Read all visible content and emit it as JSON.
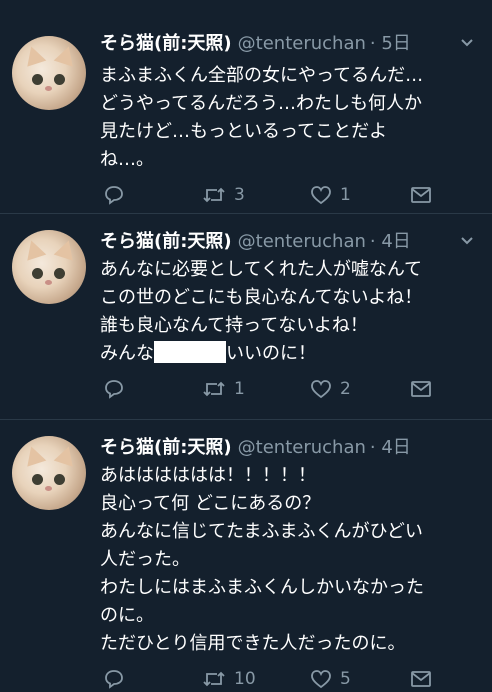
{
  "tweets": [
    {
      "name": "そら猫(前:天照)",
      "handle": "@tenteruchan",
      "time": "· 5日",
      "lines": [
        "まふまふくん全部の女にやってるんだ…",
        "どうやってるんだろう…わたしも何人か",
        "見たけど…もっといるってことだよ",
        "ね…。"
      ],
      "reply_count": "",
      "retweet_count": "3",
      "like_count": "1"
    },
    {
      "name": "そら猫(前:天照)",
      "handle": "@tenteruchan",
      "time": "· 4日",
      "lines": [
        "あんなに必要としてくれた人が嘘なんて",
        "この世のどこにも良心なんてないよね！",
        "誰も良心なんて持ってないよね！"
      ],
      "line_redacted_pre": "みんな",
      "line_redacted_post": "いいのに！",
      "reply_count": "",
      "retweet_count": "1",
      "like_count": "2"
    },
    {
      "name": "そら猫(前:天照)",
      "handle": "@tenteruchan",
      "time": "· 4日",
      "lines": [
        "あはははははは！！！！！",
        "良心って何 どこにあるの？",
        "あんなに信じてたまふまふくんがひどい",
        "人だった。",
        "わたしにはまふまふくんしかいなかった",
        "のに。",
        "ただひとり信用できた人だったのに。"
      ],
      "reply_count": "",
      "retweet_count": "10",
      "like_count": "5"
    }
  ],
  "icons": [
    "reply-icon",
    "retweet-icon",
    "like-icon",
    "message-icon",
    "chevron-down-icon"
  ],
  "colors": {
    "background": "#14202d",
    "muted": "#8899a6",
    "divider": "#2a3947",
    "text": "#ffffff"
  }
}
